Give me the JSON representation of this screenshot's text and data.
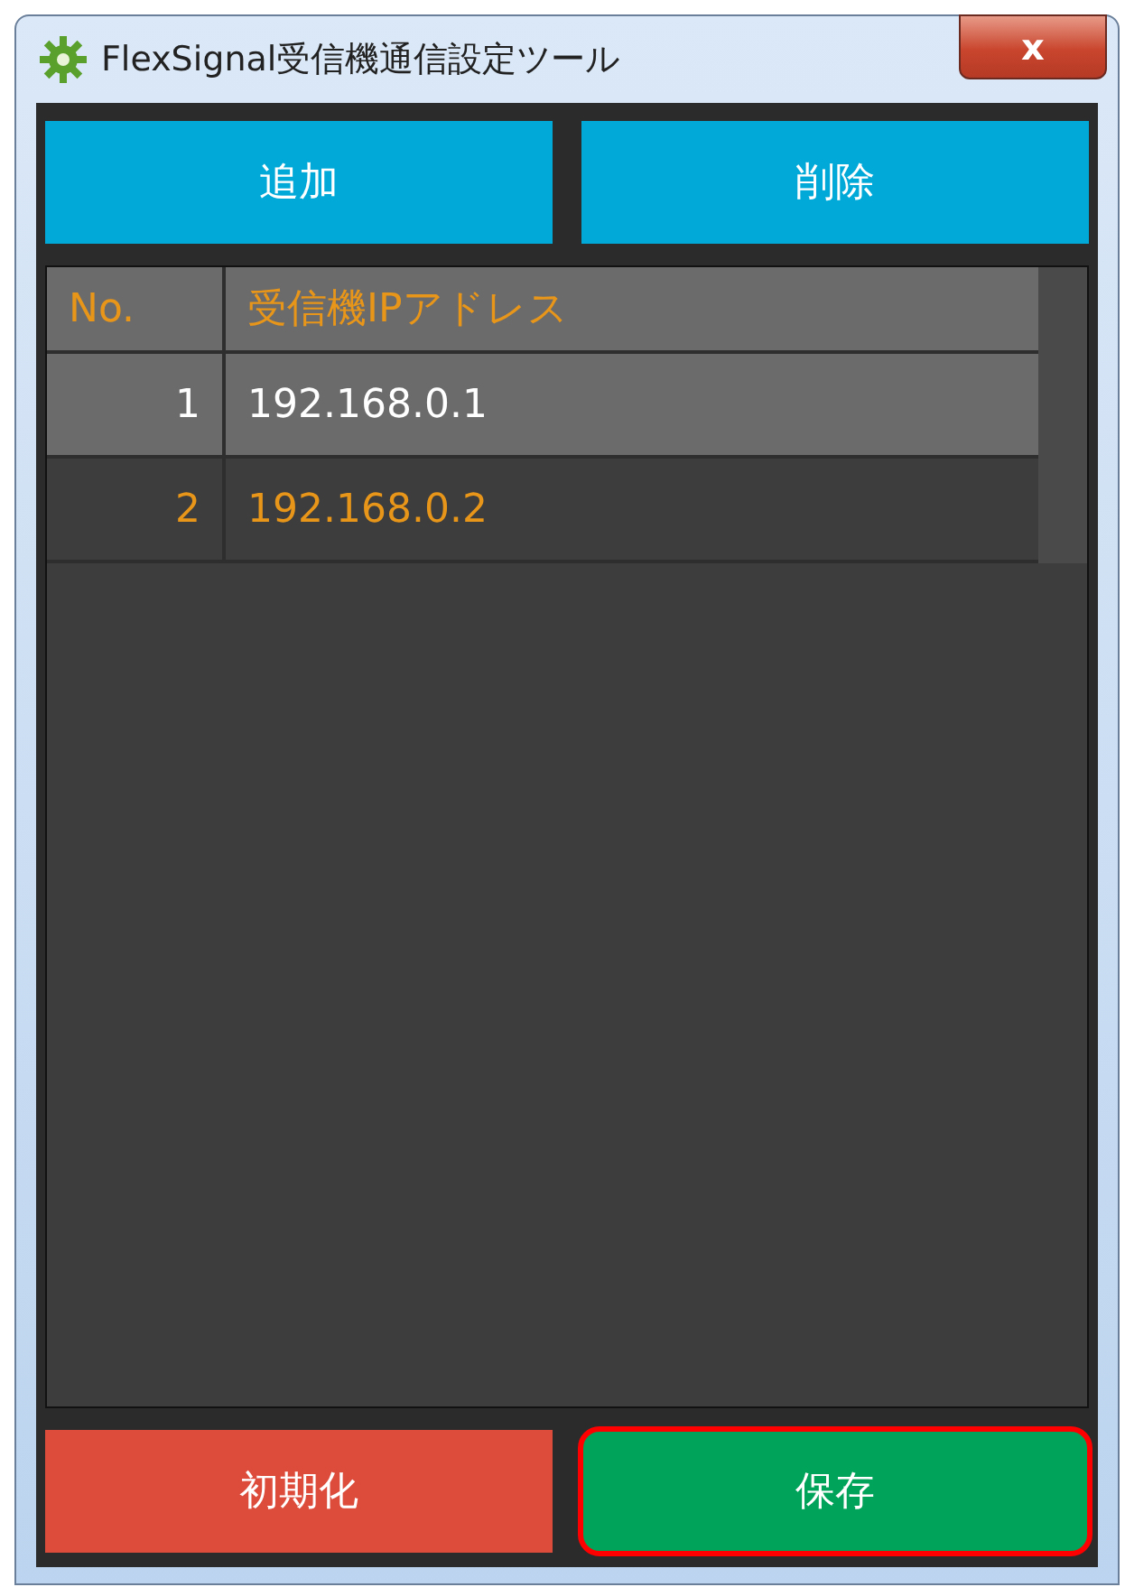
{
  "window": {
    "title": "FlexSignal受信機通信設定ツール",
    "close": "x"
  },
  "top_buttons": [
    {
      "label": "追加",
      "kind": "add",
      "highlighted": false
    },
    {
      "label": "削除",
      "kind": "add",
      "highlighted": false
    }
  ],
  "table": {
    "columns": [
      "No.",
      "受信機IPアドレス"
    ],
    "rows": [
      {
        "no": "1",
        "ip": "192.168.0.1",
        "selected": true
      },
      {
        "no": "2",
        "ip": "192.168.0.2",
        "selected": false
      }
    ]
  },
  "bottom_buttons": [
    {
      "label": "初期化",
      "kind": "reset",
      "highlighted": false
    },
    {
      "label": "保存",
      "kind": "save",
      "highlighted": true
    }
  ]
}
